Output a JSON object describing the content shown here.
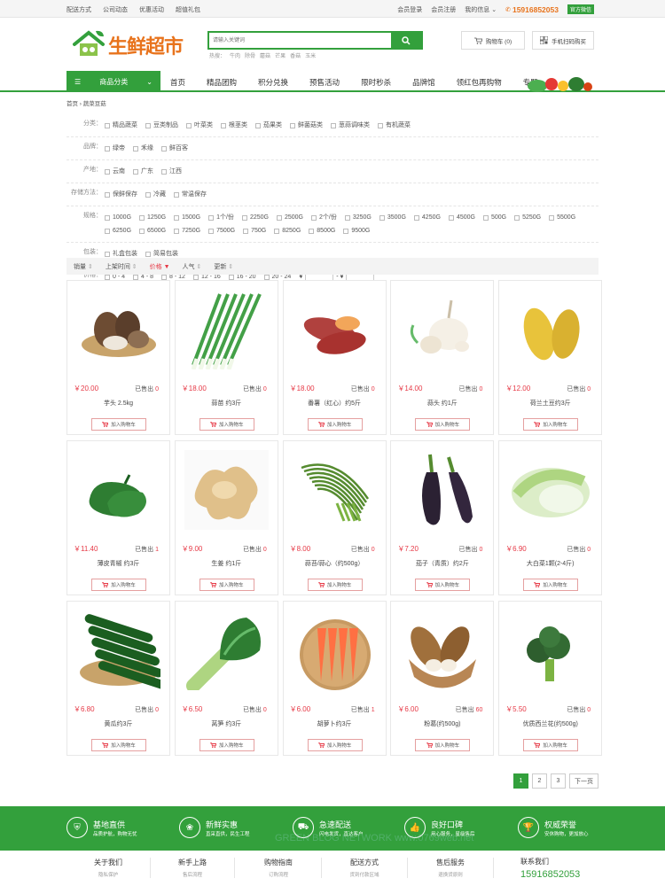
{
  "topbar": {
    "left": [
      "配送方式",
      "公司动态",
      "优惠活动",
      "超值礼包"
    ],
    "login": "会员登录",
    "register": "会员注册",
    "myinfo": "我的信息",
    "phone": "15916852053",
    "wechat": "官方微信"
  },
  "logo": {
    "text": "生鲜超市"
  },
  "search": {
    "placeholder": "请输入关键词",
    "hot_label": "热搜：",
    "hot": [
      "牛肉",
      "除骨",
      "蘑菇",
      "芒果",
      "香菇",
      "玉米"
    ]
  },
  "cart": {
    "label": "购物车 (0)"
  },
  "qr": {
    "label": "手机扫码购买"
  },
  "nav": {
    "category": "商品分类",
    "items": [
      "首页",
      "精品团购",
      "积分兑换",
      "预售活动",
      "限时秒杀",
      "品牌馆",
      "领红包再购物",
      "专题"
    ]
  },
  "breadcrumb": "首页 › 蔬菜豆菇",
  "filters": {
    "category": {
      "label": "分类：",
      "options": [
        "精品蔬菜",
        "豆类制品",
        "叶菜类",
        "根茎类",
        "茄果类",
        "鲜菌菇类",
        "葱蒜调味类",
        "有机蔬菜"
      ]
    },
    "brand": {
      "label": "品牌：",
      "options": [
        "绿帝",
        "禾缘",
        "鲜百客"
      ]
    },
    "origin": {
      "label": "产地：",
      "options": [
        "云南",
        "广东",
        "江西"
      ]
    },
    "storage": {
      "label": "存储方法：",
      "options": [
        "保鲜保存",
        "冷藏",
        "常温保存"
      ]
    },
    "spec": {
      "label": "规格：",
      "options": [
        "1000G",
        "1250G",
        "1500G",
        "1个/份",
        "2250G",
        "2500G",
        "2个/份",
        "3250G",
        "3500G",
        "4250G",
        "4500G",
        "500G",
        "5250G",
        "5500G",
        "6250G",
        "6500G",
        "7250G",
        "7500G",
        "750G",
        "8250G",
        "8500G",
        "9500G"
      ]
    },
    "pack": {
      "label": "包装：",
      "options": [
        "礼盒包装",
        "简易包装"
      ]
    },
    "price": {
      "label": "价格：",
      "options": [
        "0 - 4",
        "4 - 8",
        "8 - 12",
        "12 - 16",
        "16 - 20",
        "20 - 24"
      ],
      "yen": "¥",
      "dash": "- ¥"
    }
  },
  "sort": [
    "销量",
    "上架时间",
    "价格",
    "人气",
    "更新"
  ],
  "products": [
    {
      "price": "￥20.00",
      "sold_label": "已售出",
      "sold": "0",
      "name": "芋头 2.5kg",
      "icon": "taro"
    },
    {
      "price": "￥18.00",
      "sold_label": "已售出",
      "sold": "0",
      "name": "蒜苗 约3斤",
      "icon": "scallion"
    },
    {
      "price": "￥18.00",
      "sold_label": "已售出",
      "sold": "0",
      "name": "番薯（红心）约5斤",
      "icon": "sweet-potato"
    },
    {
      "price": "￥14.00",
      "sold_label": "已售出",
      "sold": "0",
      "name": "蒜头 约1斤",
      "icon": "garlic"
    },
    {
      "price": "￥12.00",
      "sold_label": "已售出",
      "sold": "0",
      "name": "荷兰土豆约3斤",
      "icon": "potato"
    },
    {
      "price": "￥11.40",
      "sold_label": "已售出",
      "sold": "1",
      "name": "薄皮青椒 约3斤",
      "icon": "pepper"
    },
    {
      "price": "￥9.00",
      "sold_label": "已售出",
      "sold": "0",
      "name": "生姜 约1斤",
      "icon": "ginger"
    },
    {
      "price": "￥8.00",
      "sold_label": "已售出",
      "sold": "0",
      "name": "蒜苔/蒜心（约500g）",
      "icon": "garlic-stem"
    },
    {
      "price": "￥7.20",
      "sold_label": "已售出",
      "sold": "0",
      "name": "茄子（青质）约2斤",
      "icon": "eggplant"
    },
    {
      "price": "￥6.90",
      "sold_label": "已售出",
      "sold": "0",
      "name": "大白菜1颗(2-4斤)",
      "icon": "cabbage"
    },
    {
      "price": "￥6.80",
      "sold_label": "已售出",
      "sold": "0",
      "name": "黄瓜约3斤",
      "icon": "cucumber"
    },
    {
      "price": "￥6.50",
      "sold_label": "已售出",
      "sold": "0",
      "name": "莴笋 约3斤",
      "icon": "lettuce"
    },
    {
      "price": "￥6.00",
      "sold_label": "已售出",
      "sold": "1",
      "name": "胡萝卜约3斤",
      "icon": "carrot"
    },
    {
      "price": "￥6.00",
      "sold_label": "已售出",
      "sold": "60",
      "name": "粉葛(约500g)",
      "icon": "kudzu"
    },
    {
      "price": "￥5.50",
      "sold_label": "已售出",
      "sold": "0",
      "name": "优质西兰花(约500g)",
      "icon": "broccoli"
    }
  ],
  "add_to_cart": "加入购物车",
  "pager": [
    "1",
    "2",
    "3",
    "下一页"
  ],
  "features": [
    {
      "t1": "基地直供",
      "t2": "品质护航，购物无忧",
      "icon": "shield-icon"
    },
    {
      "t1": "新鲜实惠",
      "t2": "直采直供，民生工程",
      "icon": "flower-icon"
    },
    {
      "t1": "急速配送",
      "t2": "闪电发货，直达客户",
      "icon": "truck-icon"
    },
    {
      "t1": "良好口碑",
      "t2": "用心服务，星级售后",
      "icon": "thumb-icon"
    },
    {
      "t1": "权威荣誉",
      "t2": "安休购物，更加放心",
      "icon": "trophy-icon"
    }
  ],
  "footer": [
    {
      "h": "关于我们",
      "s": "隐私保护"
    },
    {
      "h": "新手上路",
      "s": "售后流程"
    },
    {
      "h": "购物指南",
      "s": "订购流程"
    },
    {
      "h": "配送方式",
      "s": "货到付款区域"
    },
    {
      "h": "售后服务",
      "s": "退换货原则"
    }
  ],
  "footer_contact": {
    "h": "联系我们",
    "phone": "15916852053"
  },
  "watermark": "GREEN BLOG NETWORK www.0769web.net",
  "colors": {
    "brand": "#33a03c",
    "price": "#e63946",
    "accent": "#e8731c"
  }
}
